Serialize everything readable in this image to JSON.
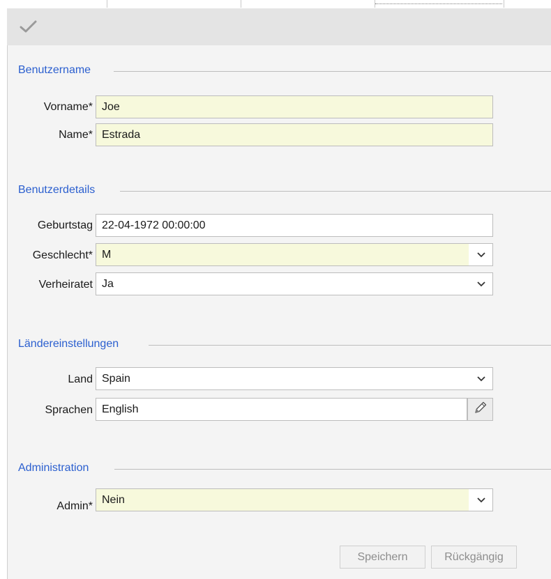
{
  "toolbar": {
    "apply_icon": "checkmark-icon"
  },
  "sections": {
    "benutzername": "Benutzername",
    "benutzerdetails": "Benutzerdetails",
    "laendereinstellungen": "Ländereinstellungen",
    "administration": "Administration"
  },
  "fields": {
    "vorname": {
      "label": "Vorname*",
      "value": "Joe"
    },
    "name": {
      "label": "Name*",
      "value": "Estrada"
    },
    "geburtstag": {
      "label": "Geburtstag",
      "value": "22-04-1972 00:00:00"
    },
    "geschlecht": {
      "label": "Geschlecht*",
      "value": "M"
    },
    "verheiratet": {
      "label": "Verheiratet",
      "value": "Ja"
    },
    "land": {
      "label": "Land",
      "value": "Spain"
    },
    "sprachen": {
      "label": "Sprachen",
      "value": "English"
    },
    "admin": {
      "label": "Admin*",
      "value": "Nein"
    }
  },
  "buttons": {
    "save": "Speichern",
    "undo": "Rückgängig"
  },
  "colors": {
    "section_title": "#2b5fcf",
    "required_bg": "#f7f9dc",
    "toolbar_bg": "#e4e4e4"
  }
}
